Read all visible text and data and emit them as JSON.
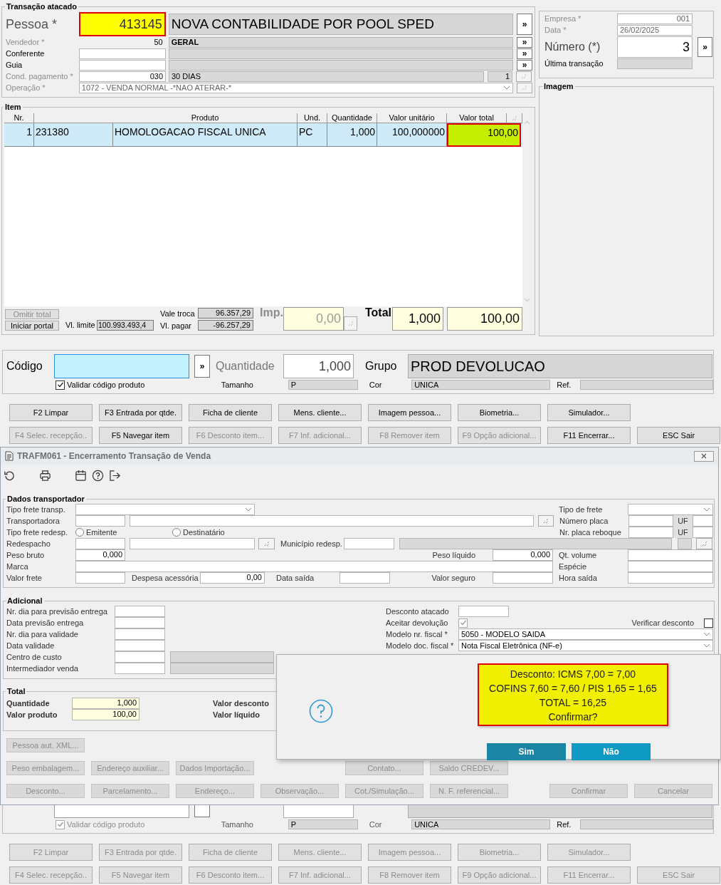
{
  "main_window": {
    "header": {
      "title": "Transação atacado",
      "pessoa": {
        "label": "Pessoa *",
        "code": "413145",
        "name": "NOVA CONTABILIDADE POR POOL SPED",
        "button": "»"
      },
      "rows": [
        {
          "kind": "lookup",
          "label": "Vendedor *",
          "code": "50",
          "name": "GERAL",
          "button": "»",
          "disabled": true
        },
        {
          "kind": "lookup",
          "label": "Conferente",
          "button": "»",
          "disabled": false
        },
        {
          "kind": "lookup",
          "label": "Guia",
          "button": "»",
          "disabled": false
        },
        {
          "kind": "count",
          "label": "Cond. pagamento *",
          "code": "030",
          "name": "30 DIAS",
          "count": "1",
          "disabled": true
        },
        {
          "kind": "combo",
          "label": "Operação *",
          "value": "1072 - VENDA NORMAL -*NAO ATERAR-*",
          "disabled": true
        }
      ]
    },
    "side": {
      "empresa": {
        "label": "Empresa *",
        "value": "001"
      },
      "data": {
        "label": "Data *",
        "value": "26/02/2025"
      },
      "numero": {
        "label": "Número (*)",
        "value": "3",
        "button": "»"
      },
      "ultima": {
        "label": "Última transação"
      },
      "image_title": "Imagem"
    },
    "items": {
      "title": "Item",
      "columns": [
        "Nr.",
        "",
        "Produto",
        "Und.",
        "Quantidade",
        "Valor unitário",
        "Valor total"
      ],
      "rows": [
        {
          "cells": [
            "1",
            "231380",
            "HOMOLOGACAO FISCAL UNICA",
            "PC",
            "1,000",
            "100,000000",
            "100,00"
          ],
          "selected": true
        }
      ]
    },
    "footer": {
      "omit": {
        "label": "Omitir total",
        "disabled": true
      },
      "portal": {
        "label": "Iniciar portal",
        "disabled": false
      },
      "limit_label": "Vl. limite",
      "limit": "100.993.493,4",
      "exchange_label": "Vale troca",
      "exchange": "96.357,29",
      "pay_label": "Vl. pagar",
      "pay": "-96.257,29",
      "imp_label": "Imp.",
      "imp": "0,00",
      "total_label": "Total",
      "total_qty": "1,000",
      "total_value": "100,00"
    },
    "lower": {
      "entry": {
        "code_label": "Código",
        "button": "»",
        "qty_label": "Quantidade",
        "qty": "1,000",
        "group_label": "Grupo",
        "group": "PROD DEVOLUCAO",
        "validate": {
          "label": "Validar código produto",
          "checked": true
        },
        "size_label": "Tamanho",
        "size": "P",
        "cor_label": "Cor",
        "cor": "UNICA",
        "ref_label": "Ref."
      },
      "buttons": [
        [
          {
            "label": "F2 Limpar",
            "disabled": false
          },
          {
            "label": "F3 Entrada por qtde.",
            "disabled": false
          },
          {
            "label": "Ficha de cliente",
            "disabled": false
          },
          {
            "label": "Mens. cliente...",
            "disabled": false
          },
          {
            "label": "Imagem pessoa...",
            "disabled": false
          },
          {
            "label": "Biometria...",
            "disabled": false
          },
          {
            "label": "Simulador...",
            "disabled": false
          }
        ],
        [
          {
            "label": "F4 Selec. recepção..",
            "disabled": true
          },
          {
            "label": "F5 Navegar item",
            "disabled": false
          },
          {
            "label": "F6 Desconto item...",
            "disabled": true
          },
          {
            "label": "F7 Inf. adicional...",
            "disabled": true
          },
          {
            "label": "F8 Remover item",
            "disabled": true
          },
          {
            "label": "F9 Opção adicional...",
            "disabled": true
          },
          {
            "label": "F11 Encerrar...",
            "disabled": false
          },
          {
            "label": "ESC Sair",
            "disabled": false
          }
        ]
      ]
    }
  },
  "dialog": {
    "title": "TRAFM061 - Encerramento Transação de Venda",
    "transport": {
      "title": "Dados transportador",
      "freight_type": {
        "label": "Tipo frete transp."
      },
      "freight_kind": {
        "label": "Tipo de frete"
      },
      "carrier": {
        "label": "Transportadora"
      },
      "plate": {
        "label": "Número placa",
        "uf": "UF"
      },
      "redesp_type": {
        "label": "Tipo frete redesp.",
        "options": [
          {
            "label": "Emitente",
            "selected": false
          },
          {
            "label": "Destinatário",
            "selected": false
          }
        ]
      },
      "trailer": {
        "label": "Nr. placa reboque",
        "uf": "UF"
      },
      "redesp": {
        "label": "Redespacho"
      },
      "city": {
        "label": "Município redesp."
      },
      "gross": {
        "label": "Peso bruto",
        "value": "0,000"
      },
      "net": {
        "label": "Peso líquido",
        "value": "0,000"
      },
      "volume": {
        "label": "Qt. volume"
      },
      "brand": {
        "label": "Marca"
      },
      "species": {
        "label": "Espécie"
      },
      "freight": {
        "label": "Valor frete"
      },
      "extra": {
        "label": "Despesa acessória",
        "value": "0,00"
      },
      "ship_date": {
        "label": "Data saída"
      },
      "insurance": {
        "label": "Valor seguro"
      },
      "ship_time": {
        "label": "Hora saída"
      }
    },
    "additional": {
      "title": "Adicional",
      "left": [
        {
          "kind": "field",
          "label": "Nr. dia para previsão entrega"
        },
        {
          "kind": "field",
          "label": "Data previsão entrega"
        },
        {
          "kind": "field",
          "label": "Nr. dia para validade"
        },
        {
          "kind": "field",
          "label": "Data validade"
        },
        {
          "kind": "lookup",
          "label": "Centro de custo"
        },
        {
          "kind": "lookup",
          "label": "Intermediador venda"
        }
      ],
      "discount": {
        "label": "Desconto atacado"
      },
      "accept": {
        "label": "Aceitar devolução",
        "checked": true
      },
      "verify": {
        "label": "Verificar desconto",
        "checked": false
      },
      "model": {
        "label": "Modelo nr. fiscal *",
        "value": "5050 - MODELO SAIDA"
      },
      "doc": {
        "label": "Modelo doc. fiscal *",
        "value": "Nota Fiscal Eletrônica (NF-e)"
      }
    },
    "totals": {
      "title": "Total",
      "quantity": {
        "label": "Quantidade",
        "value": "1,000"
      },
      "product": {
        "label": "Valor produto",
        "value": "100,00"
      },
      "discount_label": "Valor desconto",
      "net_label": "Valor líquido"
    },
    "buttons": [
      [
        {
          "label": "Pessoa aut. XML...",
          "disabled": true
        }
      ],
      [
        {
          "label": "Peso embalagem...",
          "disabled": true
        },
        {
          "label": "Endereço auxiliar...",
          "disabled": true
        },
        {
          "label": "Dados Importação...",
          "disabled": true
        },
        {
          "label": "Contato...",
          "disabled": true
        },
        {
          "label": "Saldo CREDEV...",
          "disabled": true
        }
      ],
      [
        {
          "label": "Desconto...",
          "disabled": true
        },
        {
          "label": "Parcelamento...",
          "disabled": true
        },
        {
          "label": "Endereço...",
          "disabled": true
        },
        {
          "label": "Observação...",
          "disabled": true
        },
        {
          "label": "Cot./Simulação...",
          "disabled": true
        },
        {
          "label": "N. F. referencial...",
          "disabled": true
        },
        {
          "label": "Confirmar",
          "disabled": true
        },
        {
          "label": "Cancelar",
          "disabled": true
        }
      ]
    ]
  },
  "message": {
    "lines": [
      "Desconto: ICMS 7,00 = 7,00",
      "COFINS 7,60 = 7,60 / PIS 1,65 = 1,65",
      "TOTAL = 16,25",
      "Confirmar?"
    ],
    "buttons": [
      {
        "label": "Sim",
        "selected": true
      },
      {
        "label": "Não",
        "selected": false
      }
    ]
  },
  "background_window": {
    "lower": {
      "entry": {
        "validate": {
          "label": "Validar código produto",
          "checked": true
        },
        "size_label": "Tamanho",
        "size": "P",
        "cor_label": "Cor",
        "cor": "UNICA",
        "ref_label": "Ref."
      },
      "buttons": [
        [
          {
            "label": "F2 Limpar",
            "disabled": true
          },
          {
            "label": "F3 Entrada por qtde.",
            "disabled": true
          },
          {
            "label": "Ficha de cliente",
            "disabled": true
          },
          {
            "label": "Mens. cliente...",
            "disabled": true
          },
          {
            "label": "Imagem pessoa...",
            "disabled": true
          },
          {
            "label": "Biometria...",
            "disabled": true
          },
          {
            "label": "Simulador...",
            "disabled": true
          }
        ],
        [
          {
            "label": "F4 Selec. recepção..",
            "disabled": true
          },
          {
            "label": "F5 Navegar item",
            "disabled": true
          },
          {
            "label": "F6 Desconto item...",
            "disabled": true
          },
          {
            "label": "F7 Inf. adicional...",
            "disabled": true
          },
          {
            "label": "F8 Remover item",
            "disabled": true
          },
          {
            "label": "F9 Opção adicional...",
            "disabled": true
          },
          {
            "label": "F11 Encerrar...",
            "disabled": true
          },
          {
            "label": "ESC Sair",
            "disabled": true
          }
        ]
      ]
    }
  }
}
